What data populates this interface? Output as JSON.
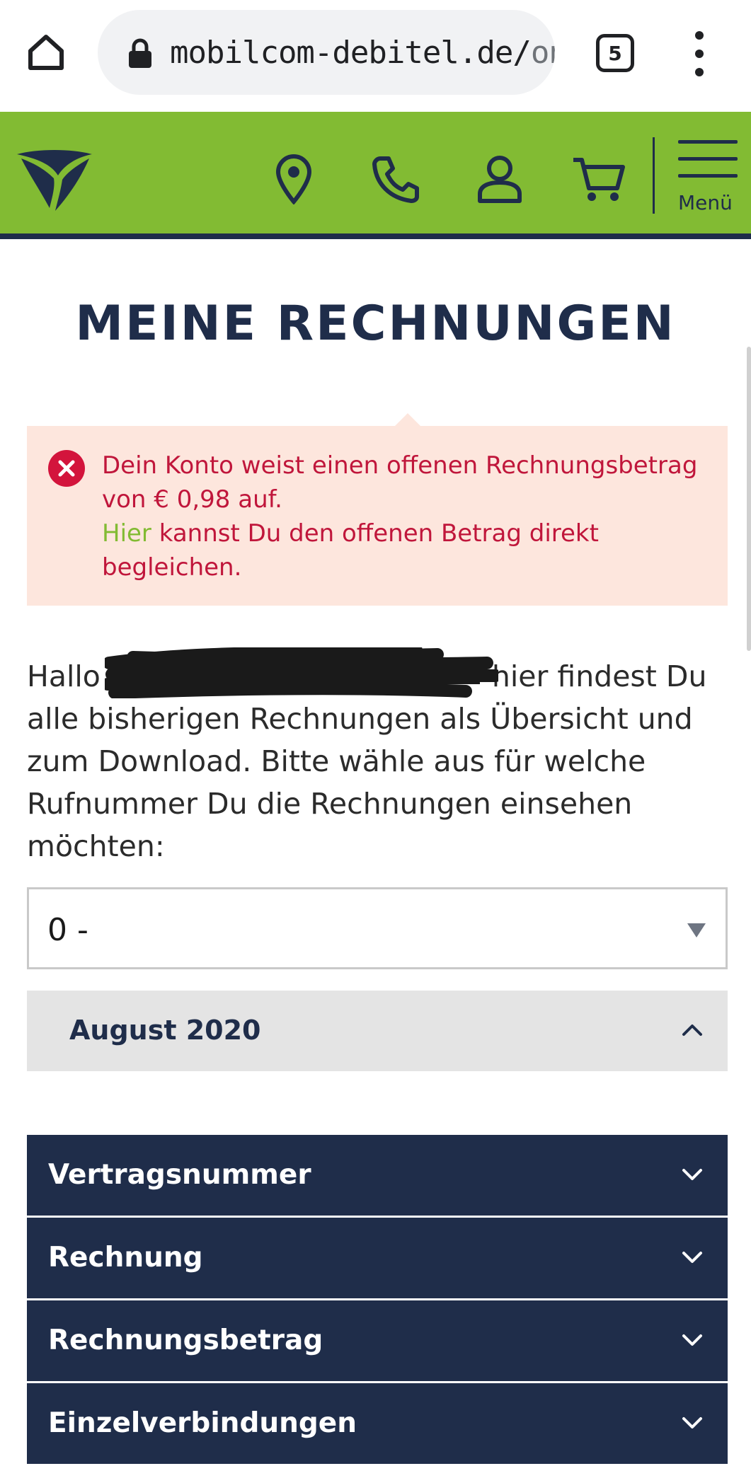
{
  "browser": {
    "url_main": "mobilcom-debitel.de/",
    "url_rest": "on",
    "tab_count": "5"
  },
  "header": {
    "menu_label": "Menü",
    "icons": [
      "location-pin-icon",
      "phone-icon",
      "user-icon",
      "cart-icon",
      "hamburger-menu-icon"
    ],
    "colors": {
      "brand_green": "#82bb33",
      "navy": "#1f2d4a"
    }
  },
  "main": {
    "title": "MEINE RECHNUNGEN",
    "alert": {
      "line1": "Dein Konto weist einen offenen Rechnungsbetrag von € 0,98 auf.",
      "link_text": "Hier",
      "line2": " kannst Du den offenen Betrag direkt begleichen.",
      "color": "#c0163b"
    },
    "intro": {
      "greeting": "Hallo",
      "text": "hier findest Du alle bisherigen Rechnungen als Übersicht und zum Download. Bitte wähle aus für welche Rufnummer Du die Rechnungen einsehen möchten:"
    },
    "phone_select": {
      "value": "0 -"
    },
    "month_accordion": {
      "label": "August 2020",
      "expanded": true
    },
    "rows": [
      {
        "label": "Vertragsnummer"
      },
      {
        "label": "Rechnung"
      },
      {
        "label": "Rechnungsbetrag"
      },
      {
        "label": "Einzelverbindungen"
      }
    ]
  }
}
